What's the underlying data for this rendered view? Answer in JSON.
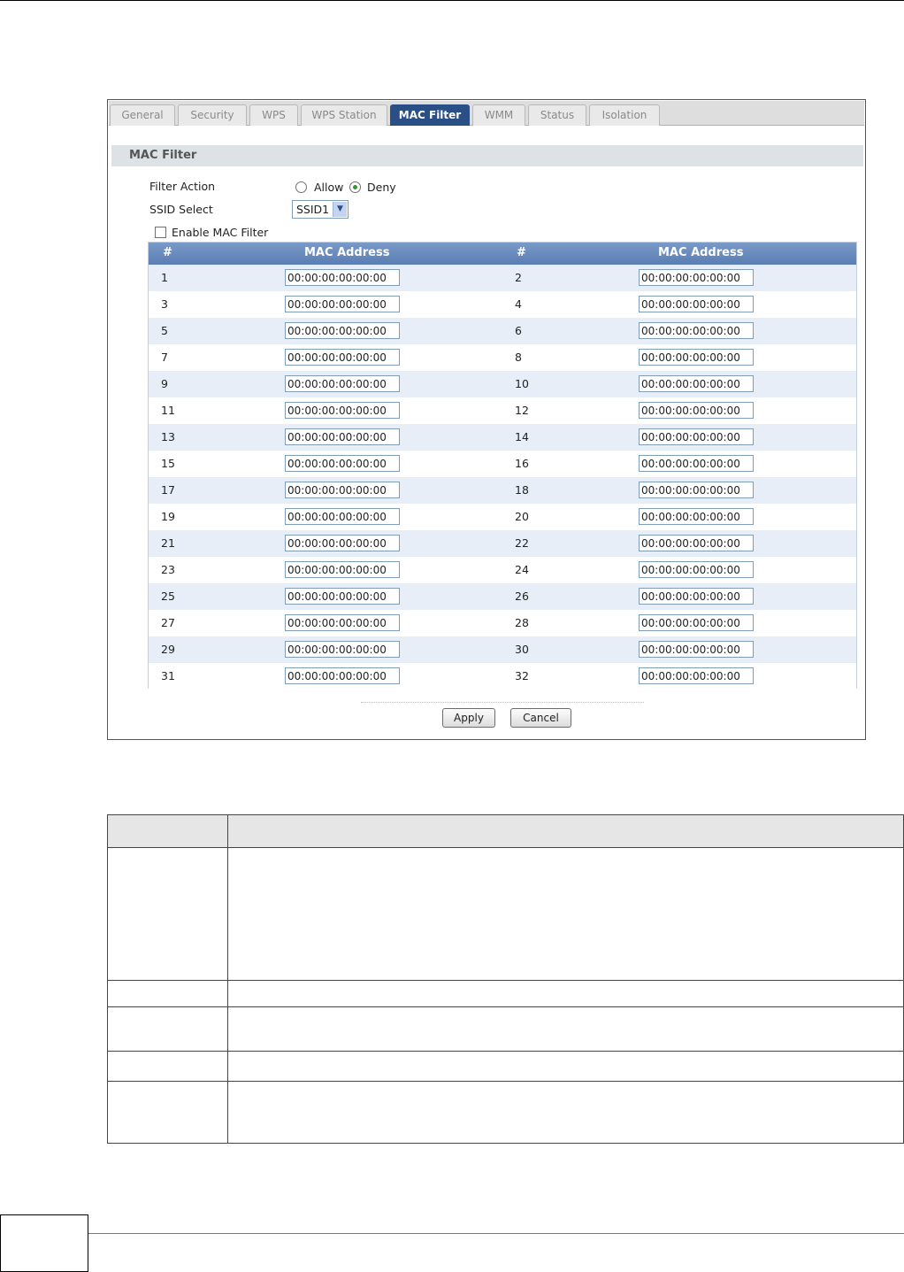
{
  "tabs": [
    {
      "label": "General"
    },
    {
      "label": "Security"
    },
    {
      "label": "WPS"
    },
    {
      "label": "WPS Station"
    },
    {
      "label": "MAC Filter",
      "active": true
    },
    {
      "label": "WMM"
    },
    {
      "label": "Status"
    },
    {
      "label": "Isolation"
    }
  ],
  "section": {
    "title": "MAC Filter"
  },
  "filter_action": {
    "label": "Filter Action",
    "allow_label": "Allow",
    "deny_label": "Deny",
    "selected": "Deny"
  },
  "ssid_select": {
    "label": "SSID Select",
    "value": "SSID1"
  },
  "enable_mac_filter": {
    "label": "Enable MAC Filter",
    "checked": false
  },
  "mac_table": {
    "headers": {
      "num_left": "#",
      "mac_left": "MAC Address",
      "num_right": "#",
      "mac_right": "MAC Address"
    },
    "rows": [
      {
        "left_num": "1",
        "left_mac": "00:00:00:00:00:00",
        "right_num": "2",
        "right_mac": "00:00:00:00:00:00"
      },
      {
        "left_num": "3",
        "left_mac": "00:00:00:00:00:00",
        "right_num": "4",
        "right_mac": "00:00:00:00:00:00"
      },
      {
        "left_num": "5",
        "left_mac": "00:00:00:00:00:00",
        "right_num": "6",
        "right_mac": "00:00:00:00:00:00"
      },
      {
        "left_num": "7",
        "left_mac": "00:00:00:00:00:00",
        "right_num": "8",
        "right_mac": "00:00:00:00:00:00"
      },
      {
        "left_num": "9",
        "left_mac": "00:00:00:00:00:00",
        "right_num": "10",
        "right_mac": "00:00:00:00:00:00"
      },
      {
        "left_num": "11",
        "left_mac": "00:00:00:00:00:00",
        "right_num": "12",
        "right_mac": "00:00:00:00:00:00"
      },
      {
        "left_num": "13",
        "left_mac": "00:00:00:00:00:00",
        "right_num": "14",
        "right_mac": "00:00:00:00:00:00"
      },
      {
        "left_num": "15",
        "left_mac": "00:00:00:00:00:00",
        "right_num": "16",
        "right_mac": "00:00:00:00:00:00"
      },
      {
        "left_num": "17",
        "left_mac": "00:00:00:00:00:00",
        "right_num": "18",
        "right_mac": "00:00:00:00:00:00"
      },
      {
        "left_num": "19",
        "left_mac": "00:00:00:00:00:00",
        "right_num": "20",
        "right_mac": "00:00:00:00:00:00"
      },
      {
        "left_num": "21",
        "left_mac": "00:00:00:00:00:00",
        "right_num": "22",
        "right_mac": "00:00:00:00:00:00"
      },
      {
        "left_num": "23",
        "left_mac": "00:00:00:00:00:00",
        "right_num": "24",
        "right_mac": "00:00:00:00:00:00"
      },
      {
        "left_num": "25",
        "left_mac": "00:00:00:00:00:00",
        "right_num": "26",
        "right_mac": "00:00:00:00:00:00"
      },
      {
        "left_num": "27",
        "left_mac": "00:00:00:00:00:00",
        "right_num": "28",
        "right_mac": "00:00:00:00:00:00"
      },
      {
        "left_num": "29",
        "left_mac": "00:00:00:00:00:00",
        "right_num": "30",
        "right_mac": "00:00:00:00:00:00"
      },
      {
        "left_num": "31",
        "left_mac": "00:00:00:00:00:00",
        "right_num": "32",
        "right_mac": "00:00:00:00:00:00"
      }
    ]
  },
  "buttons": {
    "apply_label": "Apply",
    "cancel_label": "Cancel"
  },
  "colors": {
    "active_tab": "#2a4f86",
    "table_header": "#5a7db3",
    "row_alt": "#e7eef7",
    "section_header": "#dde3e5"
  }
}
